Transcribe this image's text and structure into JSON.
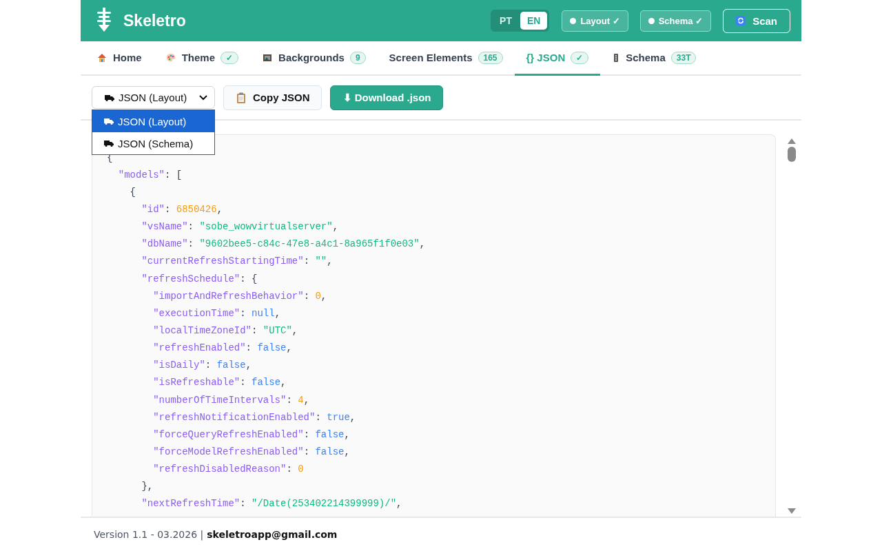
{
  "header": {
    "app_name": "Skeletro",
    "languages": [
      {
        "label": "PT",
        "selected": false
      },
      {
        "label": "EN",
        "selected": true
      }
    ],
    "toggles": [
      {
        "label": "Layout ✓",
        "on": true
      },
      {
        "label": "Schema ✓",
        "on": true
      }
    ],
    "scan_button": "Scan"
  },
  "tabs": [
    {
      "label": "Home",
      "selected": false
    },
    {
      "label": "Theme",
      "badge": "✓",
      "selected": false
    },
    {
      "label": "Backgrounds",
      "badge": "9",
      "selected": false
    },
    {
      "label": "Screen Elements",
      "badge": "165",
      "selected": false
    },
    {
      "label": "{} JSON",
      "badge": "✓",
      "selected": true
    },
    {
      "label": "Schema",
      "badge": "33T",
      "selected": false
    }
  ],
  "toolbar": {
    "format_select": {
      "value": "JSON (Layout)",
      "expanded": true,
      "options": [
        {
          "label": "JSON (Layout)",
          "selected": true
        },
        {
          "label": "JSON (Schema)",
          "selected": false
        }
      ]
    },
    "copy_button": "Copy JSON",
    "download_button": "⬇ Download .json"
  },
  "code_lines": [
    [
      {
        "kind": "punct",
        "text": "{"
      }
    ],
    [
      {
        "kind": "key",
        "text": "\"models\""
      },
      {
        "kind": "punct",
        "text": ": ["
      }
    ],
    [
      {
        "kind": "punct",
        "text": "{"
      }
    ],
    [
      {
        "kind": "key",
        "text": "\"id\""
      },
      {
        "kind": "punct",
        "text": ": "
      },
      {
        "kind": "number",
        "text": "6850426"
      },
      {
        "kind": "punct",
        "text": ","
      }
    ],
    [
      {
        "kind": "key",
        "text": "\"vsName\""
      },
      {
        "kind": "punct",
        "text": ": "
      },
      {
        "kind": "string",
        "text": "\"sobe_wowvirtualserver\""
      },
      {
        "kind": "punct",
        "text": ","
      }
    ],
    [
      {
        "kind": "key",
        "text": "\"dbName\""
      },
      {
        "kind": "punct",
        "text": ": "
      },
      {
        "kind": "string",
        "text": "\"9602bee5-c84c-47e8-a4c1-8a965f1f0e03\""
      },
      {
        "kind": "punct",
        "text": ","
      }
    ],
    [
      {
        "kind": "key",
        "text": "\"currentRefreshStartingTime\""
      },
      {
        "kind": "punct",
        "text": ": "
      },
      {
        "kind": "string",
        "text": "\"\""
      },
      {
        "kind": "punct",
        "text": ","
      }
    ],
    [
      {
        "kind": "key",
        "text": "\"refreshSchedule\""
      },
      {
        "kind": "punct",
        "text": ": {"
      }
    ],
    [
      {
        "kind": "key",
        "text": "\"importAndRefreshBehavior\""
      },
      {
        "kind": "punct",
        "text": ": "
      },
      {
        "kind": "number",
        "text": "0"
      },
      {
        "kind": "punct",
        "text": ","
      }
    ],
    [
      {
        "kind": "key",
        "text": "\"executionTime\""
      },
      {
        "kind": "punct",
        "text": ": "
      },
      {
        "kind": "literal",
        "text": "null"
      },
      {
        "kind": "punct",
        "text": ","
      }
    ],
    [
      {
        "kind": "key",
        "text": "\"localTimeZoneId\""
      },
      {
        "kind": "punct",
        "text": ": "
      },
      {
        "kind": "string",
        "text": "\"UTC\""
      },
      {
        "kind": "punct",
        "text": ","
      }
    ],
    [
      {
        "kind": "key",
        "text": "\"refreshEnabled\""
      },
      {
        "kind": "punct",
        "text": ": "
      },
      {
        "kind": "literal",
        "text": "false"
      },
      {
        "kind": "punct",
        "text": ","
      }
    ],
    [
      {
        "kind": "key",
        "text": "\"isDaily\""
      },
      {
        "kind": "punct",
        "text": ": "
      },
      {
        "kind": "literal",
        "text": "false"
      },
      {
        "kind": "punct",
        "text": ","
      }
    ],
    [
      {
        "kind": "key",
        "text": "\"isRefreshable\""
      },
      {
        "kind": "punct",
        "text": ": "
      },
      {
        "kind": "literal",
        "text": "false"
      },
      {
        "kind": "punct",
        "text": ","
      }
    ],
    [
      {
        "kind": "key",
        "text": "\"numberOfTimeIntervals\""
      },
      {
        "kind": "punct",
        "text": ": "
      },
      {
        "kind": "number",
        "text": "4"
      },
      {
        "kind": "punct",
        "text": ","
      }
    ],
    [
      {
        "kind": "key",
        "text": "\"refreshNotificationEnabled\""
      },
      {
        "kind": "punct",
        "text": ": "
      },
      {
        "kind": "literal",
        "text": "true"
      },
      {
        "kind": "punct",
        "text": ","
      }
    ],
    [
      {
        "kind": "key",
        "text": "\"forceQueryRefreshEnabled\""
      },
      {
        "kind": "punct",
        "text": ": "
      },
      {
        "kind": "literal",
        "text": "false"
      },
      {
        "kind": "punct",
        "text": ","
      }
    ],
    [
      {
        "kind": "key",
        "text": "\"forceModelRefreshEnabled\""
      },
      {
        "kind": "punct",
        "text": ": "
      },
      {
        "kind": "literal",
        "text": "false"
      },
      {
        "kind": "punct",
        "text": ","
      }
    ],
    [
      {
        "kind": "key",
        "text": "\"refreshDisabledReason\""
      },
      {
        "kind": "punct",
        "text": ": "
      },
      {
        "kind": "number",
        "text": "0"
      }
    ],
    [
      {
        "kind": "punct",
        "text": "},"
      }
    ],
    [
      {
        "kind": "key",
        "text": "\"nextRefreshTime\""
      },
      {
        "kind": "punct",
        "text": ": "
      },
      {
        "kind": "string",
        "text": "\"/Date(253402214399999)/\""
      },
      {
        "kind": "punct",
        "text": ","
      }
    ]
  ],
  "footer": {
    "version": "Version 1.1 - 03.2026 |",
    "email": "skeletroapp@gmail.com"
  }
}
